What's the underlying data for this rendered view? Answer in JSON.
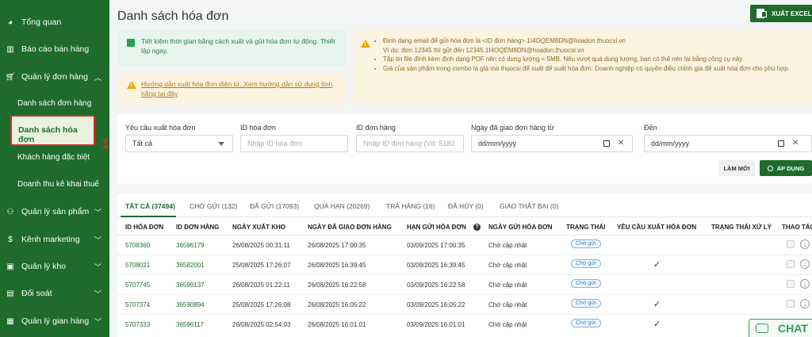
{
  "sidebar": {
    "items": [
      {
        "label": "Tổng quan",
        "icon": "pie-chart-icon"
      },
      {
        "label": "Báo cáo bán hàng",
        "icon": "bar-chart-icon"
      },
      {
        "label": "Quản lý đơn hàng",
        "icon": "cart-icon",
        "expanded": true
      },
      {
        "label": "Quản lý sản phẩm",
        "icon": "products-icon"
      },
      {
        "label": "Kênh marketing",
        "icon": "dollar-icon"
      },
      {
        "label": "Quản lý kho",
        "icon": "warehouse-icon"
      },
      {
        "label": "Đối soát",
        "icon": "reconcile-icon"
      },
      {
        "label": "Quản lý gian hàng",
        "icon": "store-icon"
      }
    ],
    "sub_items": [
      {
        "label": "Danh sách đơn hàng"
      },
      {
        "label": "Danh sách hóa đơn",
        "active": true
      },
      {
        "label": "Khách hàng đặc biệt"
      },
      {
        "label": "Doanh thu kê khai thuế"
      }
    ],
    "marker": "1"
  },
  "header": {
    "title": "Danh sách hóa đơn",
    "export_label": "XUẤT EXCEL"
  },
  "notices": {
    "green": "Tiết kiệm thời gian bằng cách xuất và gửi hóa đơn tự động. Thiết lập ngay.",
    "yellow_left": "Hướng dẫn xuất hóa đơn điện tử. Xem hướng dẫn sử dụng tính năng tại đây",
    "yellow_right": {
      "line1": "Định dạng email để gửi hóa đơn là <ID đơn hàng>.1I4OQEM8DN@hoadon.thuocsi.vn",
      "line1_sub": "Ví dụ: đơn 12345 thì gửi đến 12345.1I4OQEM8DN@hoadon.thuocsi.vn",
      "line2": "Tập tin file đính kèm định dạng PDF nên có dung lượng < 5MB. Nếu vượt quá dung lượng, bạn có thể nén lại bằng công cụ này",
      "line3": "Giá của sản phẩm trong combo là giá mà thuocsi để xuất để xuất hóa đơn. Doanh nghiệp có quyền điều chỉnh giá để xuất hóa đơn cho phù hợp."
    }
  },
  "filters": {
    "invoice_request": {
      "label": "Yêu cầu xuất hóa đơn",
      "value": "Tất cả"
    },
    "invoice_id": {
      "label": "ID hóa đơn",
      "placeholder": "Nhập ID hóa đơn"
    },
    "order_id": {
      "label": "ID đơn hàng",
      "placeholder": "Nhập ID đơn hàng (Vd. 5182"
    },
    "date_from": {
      "label": "Ngày đã giao đơn hàng từ",
      "value": "dd/mm/yyyy"
    },
    "date_to": {
      "label": "Đến",
      "value": "dd/mm/yyyy"
    },
    "reset_label": "LÀM MỚI",
    "apply_label": "ÁP DỤNG"
  },
  "tabs": [
    {
      "label": "TẤT CẢ (37494)",
      "active": true
    },
    {
      "label": "CHỜ GỬI (132)"
    },
    {
      "label": "ĐÃ GỬI (17093)"
    },
    {
      "label": "QUÁ HẠN (20269)"
    },
    {
      "label": "TRẢ HÀNG (16)"
    },
    {
      "label": "ĐÃ HỦY (0)"
    },
    {
      "label": "GIAO THẤT BẠI (0)"
    }
  ],
  "table": {
    "columns": [
      "ID HÓA ĐƠN",
      "ID ĐƠN HÀNG",
      "NGÀY XUẤT KHO",
      "NGÀY ĐÃ GIAO ĐƠN HÀNG",
      "HẠN GỬI HÓA ĐƠN",
      "NGÀY GỬI HÓA ĐƠN",
      "TRẠNG THÁI",
      "YÊU CẦU XUẤT HÓA ĐƠN",
      "TRẠNG THÁI XỬ LÝ",
      "THAO TÁC"
    ],
    "rows": [
      {
        "invoice_id": "5708360",
        "order_id": "36596179",
        "export_date": "26/08/2025 00:31:11",
        "delivered_date": "26/08/2025 17:00:35",
        "deadline": "03/09/2025 17:00:35",
        "sent_date": "Chờ cập nhật",
        "status": "Chờ gửi",
        "requested": false
      },
      {
        "invoice_id": "5708021",
        "order_id": "36582001",
        "export_date": "25/08/2025 17:26:07",
        "delivered_date": "26/08/2025 16:39:45",
        "deadline": "03/09/2025 16:39:45",
        "sent_date": "Chờ cập nhật",
        "status": "Chờ gửi",
        "requested": true
      },
      {
        "invoice_id": "5707745",
        "order_id": "36599137",
        "export_date": "26/08/2025 01:22:11",
        "delivered_date": "26/08/2025 16:22:58",
        "deadline": "03/09/2025 16:22:58",
        "sent_date": "Chờ cập nhật",
        "status": "Chờ gửi",
        "requested": false
      },
      {
        "invoice_id": "5707374",
        "order_id": "36590894",
        "export_date": "25/08/2025 17:26:08",
        "delivered_date": "26/08/2025 16:05:22",
        "deadline": "03/09/2025 16:05:22",
        "sent_date": "Chờ cập nhật",
        "status": "Chờ gửi",
        "requested": true
      },
      {
        "invoice_id": "5707333",
        "order_id": "36596117",
        "export_date": "26/08/2025 02:54:03",
        "delivered_date": "26/08/2025 16:01:01",
        "deadline": "03/09/2025 16:01:01",
        "sent_date": "Chờ cập nhật",
        "status": "Chờ gửi",
        "requested": true
      }
    ],
    "check_mark": "✓"
  },
  "chat": {
    "label": "CHAT"
  },
  "colors": {
    "brand": "#1e6b2c",
    "accent_green": "#2a9d52",
    "marker_red": "#d32f2f"
  }
}
